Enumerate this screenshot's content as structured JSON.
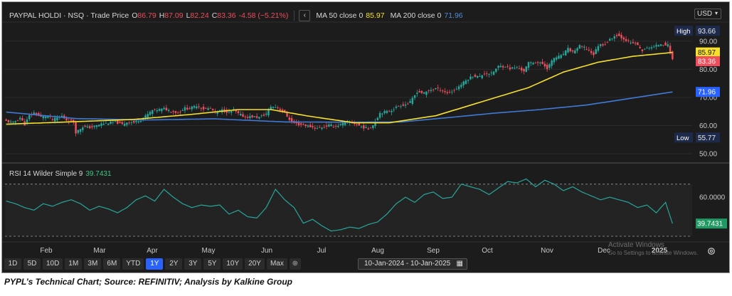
{
  "header": {
    "instrument": "PAYPAL HOLDI · NSQ · Trade Price",
    "o_label": "O",
    "o_value": "86.79",
    "h_label": "H",
    "h_value": "87.09",
    "l_label": "L",
    "l_value": "82.24",
    "c_label": "C",
    "c_value": "83.36",
    "change": "-4.58 (−5.21%)",
    "ma50_label": "MA 50 close 0",
    "ma50_value": "85.97",
    "ma200_label": "MA 200 close 0",
    "ma200_value": "71.96",
    "currency": "USD"
  },
  "rsi_panel": {
    "label": "RSI 14 Wilder Simple 9",
    "value": "39.7431",
    "axis_tick": "60.0000"
  },
  "timeframes": [
    "1D",
    "5D",
    "10D",
    "1M",
    "3M",
    "6M",
    "YTD",
    "1Y",
    "2Y",
    "3Y",
    "5Y",
    "10Y",
    "20Y",
    "Max"
  ],
  "active_timeframe": "1Y",
  "date_range": "10-Jan-2024 - 10-Jan-2025",
  "watermark": {
    "line1": "Activate Windows",
    "line2": "Go to Settings to activate Windows."
  },
  "caption": "PYPL’s Technical Chart; Source: REFINITIV; Analysis by Kalkine Group",
  "colors": {
    "up": "#26a69a",
    "down": "#ef4d5c",
    "ma50": "#f6e02c",
    "ma200": "#3f7bd6",
    "rsi": "#26a69a",
    "background": "#1c1c1c"
  },
  "icons": {
    "collapse": "chevron-left-icon",
    "settings": "gear-icon",
    "compare": "plus-circle-icon",
    "calendar": "calendar-icon"
  },
  "chart_data": {
    "type": "candlestick",
    "title": "PAYPAL HOLDI · NSQ · Trade Price",
    "y_ticks": [
      50,
      60,
      70,
      80,
      90
    ],
    "ylim": [
      47.5,
      96.0
    ],
    "x_ticks": [
      "Feb",
      "Mar",
      "Apr",
      "May",
      "Jun",
      "Jul",
      "Aug",
      "Sep",
      "Oct",
      "Nov",
      "Dec",
      "2025"
    ],
    "price_labels": [
      {
        "name": "High",
        "value": 93.66,
        "text": "93.66"
      },
      {
        "name": "MA 50",
        "value": 85.97,
        "text": "85.97"
      },
      {
        "name": "Close",
        "value": 83.36,
        "text": "83.36"
      },
      {
        "name": "MA 200",
        "value": 71.96,
        "text": "71.96"
      },
      {
        "name": "Low",
        "value": 55.77,
        "text": "55.77"
      }
    ],
    "price_path": [
      [
        0,
        61.6
      ],
      [
        3,
        61.0
      ],
      [
        6,
        62.8
      ],
      [
        8,
        60.4
      ],
      [
        10,
        63.5
      ],
      [
        12,
        64.5
      ],
      [
        15,
        63.0
      ],
      [
        18,
        63.5
      ],
      [
        20,
        62.0
      ],
      [
        24,
        63.4
      ],
      [
        26,
        62.0
      ],
      [
        29,
        61.3
      ],
      [
        30,
        57.6
      ],
      [
        33,
        59.6
      ],
      [
        36,
        59.3
      ],
      [
        38,
        59.7
      ],
      [
        41,
        60.6
      ],
      [
        44,
        60.9
      ],
      [
        47,
        61.3
      ],
      [
        50,
        60.4
      ],
      [
        52,
        61.2
      ],
      [
        55,
        61.1
      ],
      [
        58,
        62.1
      ],
      [
        60,
        63.3
      ],
      [
        63,
        65.4
      ],
      [
        66,
        65.7
      ],
      [
        68,
        66.0
      ],
      [
        71,
        65.2
      ],
      [
        74,
        64.5
      ],
      [
        77,
        66.2
      ],
      [
        79,
        66.0
      ],
      [
        82,
        67.1
      ],
      [
        85,
        65.9
      ],
      [
        88,
        66.1
      ],
      [
        90,
        64.7
      ],
      [
        93,
        65.5
      ],
      [
        96,
        64.7
      ],
      [
        98,
        65.5
      ],
      [
        100,
        64.2
      ],
      [
        103,
        63.0
      ],
      [
        106,
        63.2
      ],
      [
        109,
        62.9
      ],
      [
        112,
        64.2
      ],
      [
        114,
        66.8
      ],
      [
        117,
        66.4
      ],
      [
        120,
        64.4
      ],
      [
        123,
        61.2
      ],
      [
        126,
        60.4
      ],
      [
        128,
        60.3
      ],
      [
        131,
        59.6
      ],
      [
        134,
        59.0
      ],
      [
        137,
        59.6
      ],
      [
        139,
        60.1
      ],
      [
        142,
        59.8
      ],
      [
        145,
        60.7
      ],
      [
        147,
        61.2
      ],
      [
        150,
        60.8
      ],
      [
        153,
        59.6
      ],
      [
        156,
        58.8
      ],
      [
        158,
        60.2
      ],
      [
        161,
        64.5
      ],
      [
        164,
        65.0
      ],
      [
        166,
        65.5
      ],
      [
        169,
        67.0
      ],
      [
        172,
        67.5
      ],
      [
        174,
        68.3
      ],
      [
        177,
        72.0
      ],
      [
        180,
        71.5
      ],
      [
        182,
        72.5
      ],
      [
        185,
        73.2
      ],
      [
        188,
        72.5
      ],
      [
        190,
        71.5
      ],
      [
        193,
        72.5
      ],
      [
        196,
        74.6
      ],
      [
        198,
        76.0
      ],
      [
        201,
        77.7
      ],
      [
        204,
        77.3
      ],
      [
        206,
        78.6
      ],
      [
        209,
        78.4
      ],
      [
        212,
        81.0
      ],
      [
        215,
        81.1
      ],
      [
        217,
        80.3
      ],
      [
        220,
        80.6
      ],
      [
        223,
        79.4
      ],
      [
        225,
        82.2
      ],
      [
        228,
        82.5
      ],
      [
        231,
        81.9
      ],
      [
        233,
        80.4
      ],
      [
        236,
        84.0
      ],
      [
        239,
        84.7
      ],
      [
        242,
        87.2
      ],
      [
        244,
        86.1
      ],
      [
        247,
        88.2
      ],
      [
        250,
        87.3
      ],
      [
        253,
        85.2
      ],
      [
        255,
        88.5
      ],
      [
        258,
        89.0
      ],
      [
        261,
        91.2
      ],
      [
        263,
        92.2
      ],
      [
        266,
        90.9
      ],
      [
        269,
        89.2
      ],
      [
        271,
        89.2
      ],
      [
        274,
        86.6
      ],
      [
        277,
        87.8
      ],
      [
        279,
        87.9
      ],
      [
        282,
        89.1
      ],
      [
        285,
        88.5
      ],
      [
        287,
        83.4
      ]
    ],
    "ma50_curve": [
      [
        0,
        60.5
      ],
      [
        30,
        61.4
      ],
      [
        55,
        62.2
      ],
      [
        80,
        64.0
      ],
      [
        100,
        65.7
      ],
      [
        114,
        65.7
      ],
      [
        130,
        63.4
      ],
      [
        150,
        61.0
      ],
      [
        165,
        61.0
      ],
      [
        185,
        63.5
      ],
      [
        205,
        68.5
      ],
      [
        225,
        73.5
      ],
      [
        240,
        79.0
      ],
      [
        255,
        82.5
      ],
      [
        270,
        84.6
      ],
      [
        287,
        85.97
      ]
    ],
    "ma200_curve": [
      [
        0,
        64.8
      ],
      [
        30,
        62.5
      ],
      [
        60,
        62.0
      ],
      [
        90,
        62.4
      ],
      [
        120,
        61.3
      ],
      [
        150,
        61.2
      ],
      [
        170,
        61.3
      ],
      [
        190,
        62.8
      ],
      [
        210,
        64.4
      ],
      [
        230,
        65.7
      ],
      [
        250,
        67.3
      ],
      [
        270,
        69.8
      ],
      [
        287,
        71.96
      ]
    ],
    "rsi_curve": [
      [
        0,
        57
      ],
      [
        4,
        55
      ],
      [
        8,
        52
      ],
      [
        12,
        50
      ],
      [
        16,
        55
      ],
      [
        20,
        53
      ],
      [
        24,
        56
      ],
      [
        28,
        58
      ],
      [
        32,
        55
      ],
      [
        36,
        50
      ],
      [
        40,
        53
      ],
      [
        44,
        51
      ],
      [
        48,
        48
      ],
      [
        52,
        52
      ],
      [
        56,
        58
      ],
      [
        60,
        61
      ],
      [
        64,
        57
      ],
      [
        68,
        66
      ],
      [
        72,
        60
      ],
      [
        76,
        55
      ],
      [
        80,
        52
      ],
      [
        84,
        54
      ],
      [
        88,
        53
      ],
      [
        92,
        54
      ],
      [
        96,
        47
      ],
      [
        100,
        50
      ],
      [
        104,
        45
      ],
      [
        108,
        44
      ],
      [
        112,
        52
      ],
      [
        116,
        66
      ],
      [
        120,
        58
      ],
      [
        124,
        52
      ],
      [
        128,
        40
      ],
      [
        132,
        43
      ],
      [
        136,
        38
      ],
      [
        140,
        34
      ],
      [
        144,
        35
      ],
      [
        148,
        37
      ],
      [
        152,
        36
      ],
      [
        156,
        39
      ],
      [
        160,
        41
      ],
      [
        164,
        47
      ],
      [
        168,
        55
      ],
      [
        172,
        60
      ],
      [
        176,
        56
      ],
      [
        180,
        62
      ],
      [
        184,
        64
      ],
      [
        188,
        59
      ],
      [
        192,
        60
      ],
      [
        196,
        70
      ],
      [
        200,
        68
      ],
      [
        204,
        66
      ],
      [
        208,
        62
      ],
      [
        212,
        67
      ],
      [
        216,
        72
      ],
      [
        220,
        71
      ],
      [
        224,
        74
      ],
      [
        228,
        68
      ],
      [
        232,
        73
      ],
      [
        236,
        70
      ],
      [
        240,
        65
      ],
      [
        244,
        68
      ],
      [
        248,
        64
      ],
      [
        252,
        61
      ],
      [
        256,
        58
      ],
      [
        260,
        60
      ],
      [
        264,
        58
      ],
      [
        268,
        56
      ],
      [
        272,
        52
      ],
      [
        276,
        54
      ],
      [
        280,
        48
      ],
      [
        284,
        56
      ],
      [
        287,
        39.74
      ]
    ],
    "rsi_ylim": [
      30,
      77
    ],
    "rsi_lines": [
      70,
      30
    ]
  }
}
